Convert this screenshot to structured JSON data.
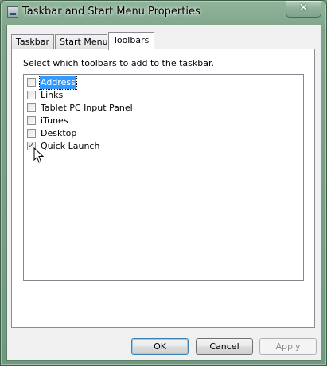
{
  "window": {
    "title": "Taskbar and Start Menu Properties",
    "close_label": "✕"
  },
  "tabs": [
    {
      "label": "Taskbar"
    },
    {
      "label": "Start Menu"
    },
    {
      "label": "Toolbars"
    }
  ],
  "active_tab": "Toolbars",
  "panel": {
    "instruction": "Select which toolbars to add to the taskbar.",
    "toolbars": [
      {
        "label": "Address",
        "checked": false,
        "selected": true
      },
      {
        "label": "Links",
        "checked": false,
        "selected": false
      },
      {
        "label": "Tablet PC Input Panel",
        "checked": false,
        "selected": false
      },
      {
        "label": "iTunes",
        "checked": false,
        "selected": false
      },
      {
        "label": "Desktop",
        "checked": false,
        "selected": false
      },
      {
        "label": "Quick Launch",
        "checked": true,
        "selected": false
      }
    ]
  },
  "buttons": {
    "ok": "OK",
    "cancel": "Cancel",
    "apply": "Apply"
  },
  "icons": {
    "app": "taskbar-properties-icon",
    "close": "close-icon",
    "cursor": "mouse-pointer-icon"
  }
}
